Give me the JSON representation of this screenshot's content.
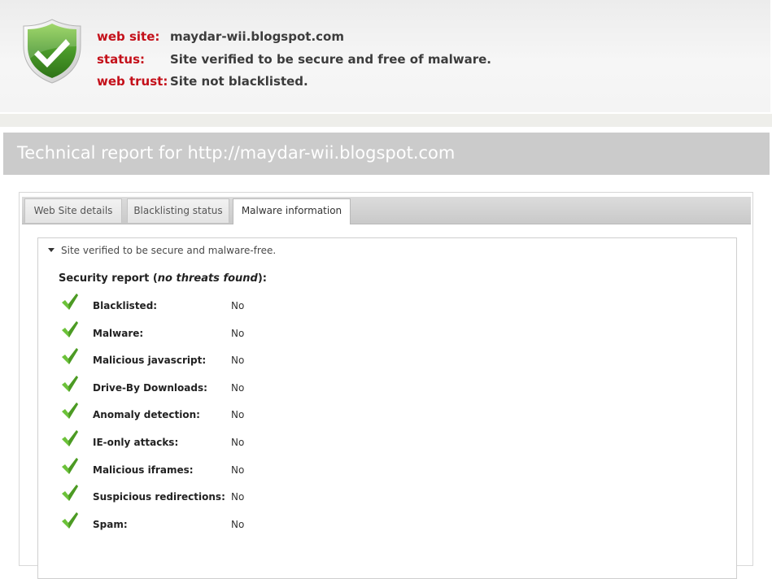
{
  "summary": {
    "rows": [
      {
        "label": "web site:",
        "value": "maydar-wii.blogspot.com"
      },
      {
        "label": "status:",
        "value": "Site verified to be secure and free of malware."
      },
      {
        "label": "web trust:",
        "value": "Site not blacklisted."
      }
    ],
    "icon": "shield-check-icon",
    "shield_color": "#4a9a2a",
    "label_color": "#c4101a"
  },
  "report": {
    "title": "Technical report for http://maydar-wii.blogspot.com"
  },
  "tabs": [
    {
      "label": "Web Site details",
      "active": false
    },
    {
      "label": "Blacklisting status",
      "active": false
    },
    {
      "label": "Malware information",
      "active": true
    }
  ],
  "malware": {
    "disclosure": "Site verified to be secure and malware-free.",
    "heading_prefix": "Security report (",
    "heading_emphasis": "no threats found",
    "heading_suffix": "):",
    "checks": [
      {
        "label": "Blacklisted:",
        "value": "No"
      },
      {
        "label": "Malware:",
        "value": "No"
      },
      {
        "label": "Malicious javascript:",
        "value": "No"
      },
      {
        "label": "Drive-By Downloads:",
        "value": "No"
      },
      {
        "label": "Anomaly detection:",
        "value": "No"
      },
      {
        "label": "IE-only attacks:",
        "value": "No"
      },
      {
        "label": "Malicious iframes:",
        "value": "No"
      },
      {
        "label": "Suspicious redirections:",
        "value": "No"
      },
      {
        "label": "Spam:",
        "value": "No"
      }
    ],
    "check_icon": "green-check-icon",
    "check_color": "#6cc23a"
  }
}
